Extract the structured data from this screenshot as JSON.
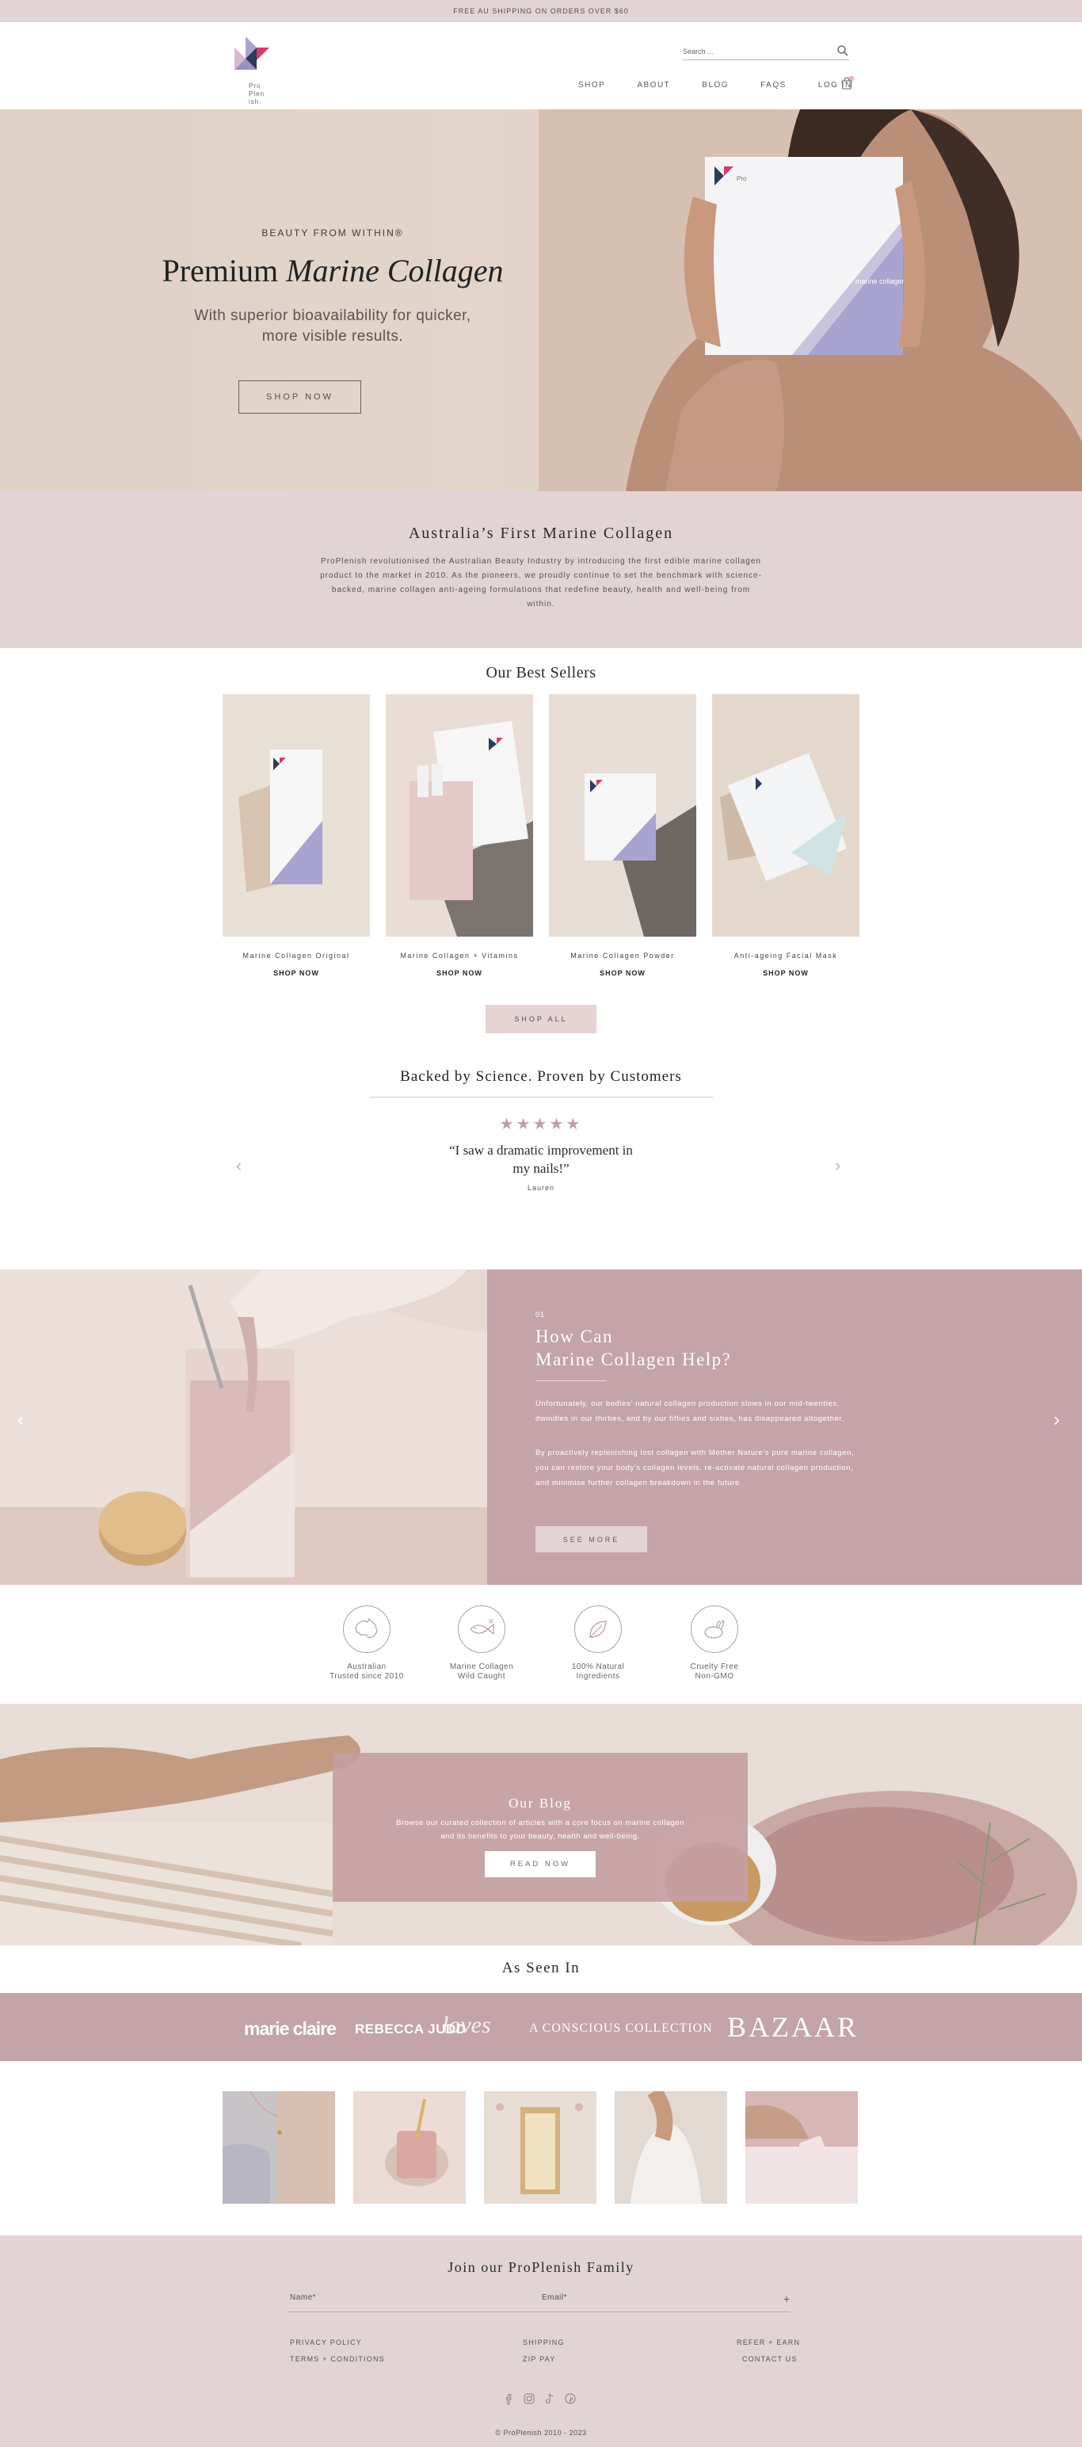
{
  "announcement": {
    "text": "FREE AU SHIPPING ON ORDERS OVER $60"
  },
  "header": {
    "logo_text": "Pro\nPlen\nish.",
    "search_placeholder": "Search ...",
    "nav": [
      "SHOP",
      "ABOUT",
      "BLOG",
      "FAQS",
      "LOG IN"
    ],
    "cart_count": "0"
  },
  "hero": {
    "eyebrow": "BEAUTY FROM WITHIN®",
    "title_plain": "Premium ",
    "title_italic": "Marine Collagen",
    "subtitle_line1": "With superior bioavailability for quicker,",
    "subtitle_line2": "more visible results.",
    "button": "SHOP NOW",
    "box_label": "marine collagen"
  },
  "about": {
    "title": "Australia’s First Marine Collagen",
    "text": "ProPlenish revolutionised the Australian Beauty Industry by introducing the first edible marine collagen product to the market in 2010. As the pioneers, we proudly continue to set the benchmark with science-backed, marine collagen anti-ageing formulations that redefine beauty, health and well-being from within."
  },
  "best_sellers": {
    "title": "Our Best Sellers",
    "products": [
      {
        "name": "Marine Collagen Original",
        "cta": "SHOP NOW"
      },
      {
        "name": "Marine Collagen + Vitamins",
        "cta": "SHOP NOW"
      },
      {
        "name": "Marine Collagen Powder",
        "cta": "SHOP NOW"
      },
      {
        "name": "Anti-ageing Facial Mask",
        "cta": "SHOP NOW"
      }
    ],
    "shop_all": "SHOP ALL"
  },
  "reviews": {
    "title": "Backed by Science. Proven by Customers",
    "stars": "★★★★★",
    "rating": 5,
    "quote_line1": "“I saw a dramatic improvement in",
    "quote_line2": "my nails!”",
    "author": "Lauren",
    "prev": "‹",
    "next": "›"
  },
  "help": {
    "number": "01",
    "title_line1": "How Can",
    "title_line2": "Marine Collagen Help?",
    "para1": "Unfortunately, our bodies' natural collagen production slows in our mid-twenties, dwindles in our thirties, and by our fifties and sixties, has disappeared altogether.",
    "para2": "By proactively replenishing lost collagen with Mother Nature's pure marine collagen, you can restore your body's collagen levels, re-activate natural collagen production, and minimise further collagen breakdown in the future.",
    "button": "SEE MORE",
    "prev": "‹",
    "next": "›"
  },
  "features": [
    {
      "line1": "Australian",
      "line2": "Trusted since 2010",
      "icon": "australia-map-icon"
    },
    {
      "line1": "Marine Collagen",
      "line2": "Wild Caught",
      "icon": "fish-icon"
    },
    {
      "line1": "100% Natural",
      "line2": "Ingredients",
      "icon": "leaf-icon"
    },
    {
      "line1": "Cruelty Free",
      "line2": "Non-GMO",
      "icon": "bunny-icon"
    }
  ],
  "blog": {
    "title": "Our Blog",
    "text_line1": "Browse our curated collection of articles with a core focus on marine collagen",
    "text_line2": "and its benefits to your beauty, health and well-being.",
    "button": "READ NOW"
  },
  "as_seen_in": {
    "title": "As Seen In",
    "brands": [
      "marie claire",
      "REBECCA JUDD",
      "loves",
      "A CONSCIOUS COLLECTION",
      "BAZAAR"
    ]
  },
  "footer": {
    "title": "Join our ProPlenish Family",
    "name_label": "Name*",
    "email_label": "Email*",
    "submit": "+",
    "links": {
      "privacy": "PRIVACY POLICY",
      "terms": "TERMS + CONDITIONS",
      "shipping": "SHIPPING",
      "zip": "ZIP PAY",
      "refer": "REFER + EARN",
      "contact": "CONTACT US"
    },
    "copyright": "© ProPlenish 2010 - 2023"
  },
  "colors": {
    "blush": "#e2d4d4",
    "mauve": "#c4a4a8",
    "lavender": "#a9a3cf",
    "pink_accent": "#d63a6b",
    "navy_accent": "#2a3b5c"
  }
}
